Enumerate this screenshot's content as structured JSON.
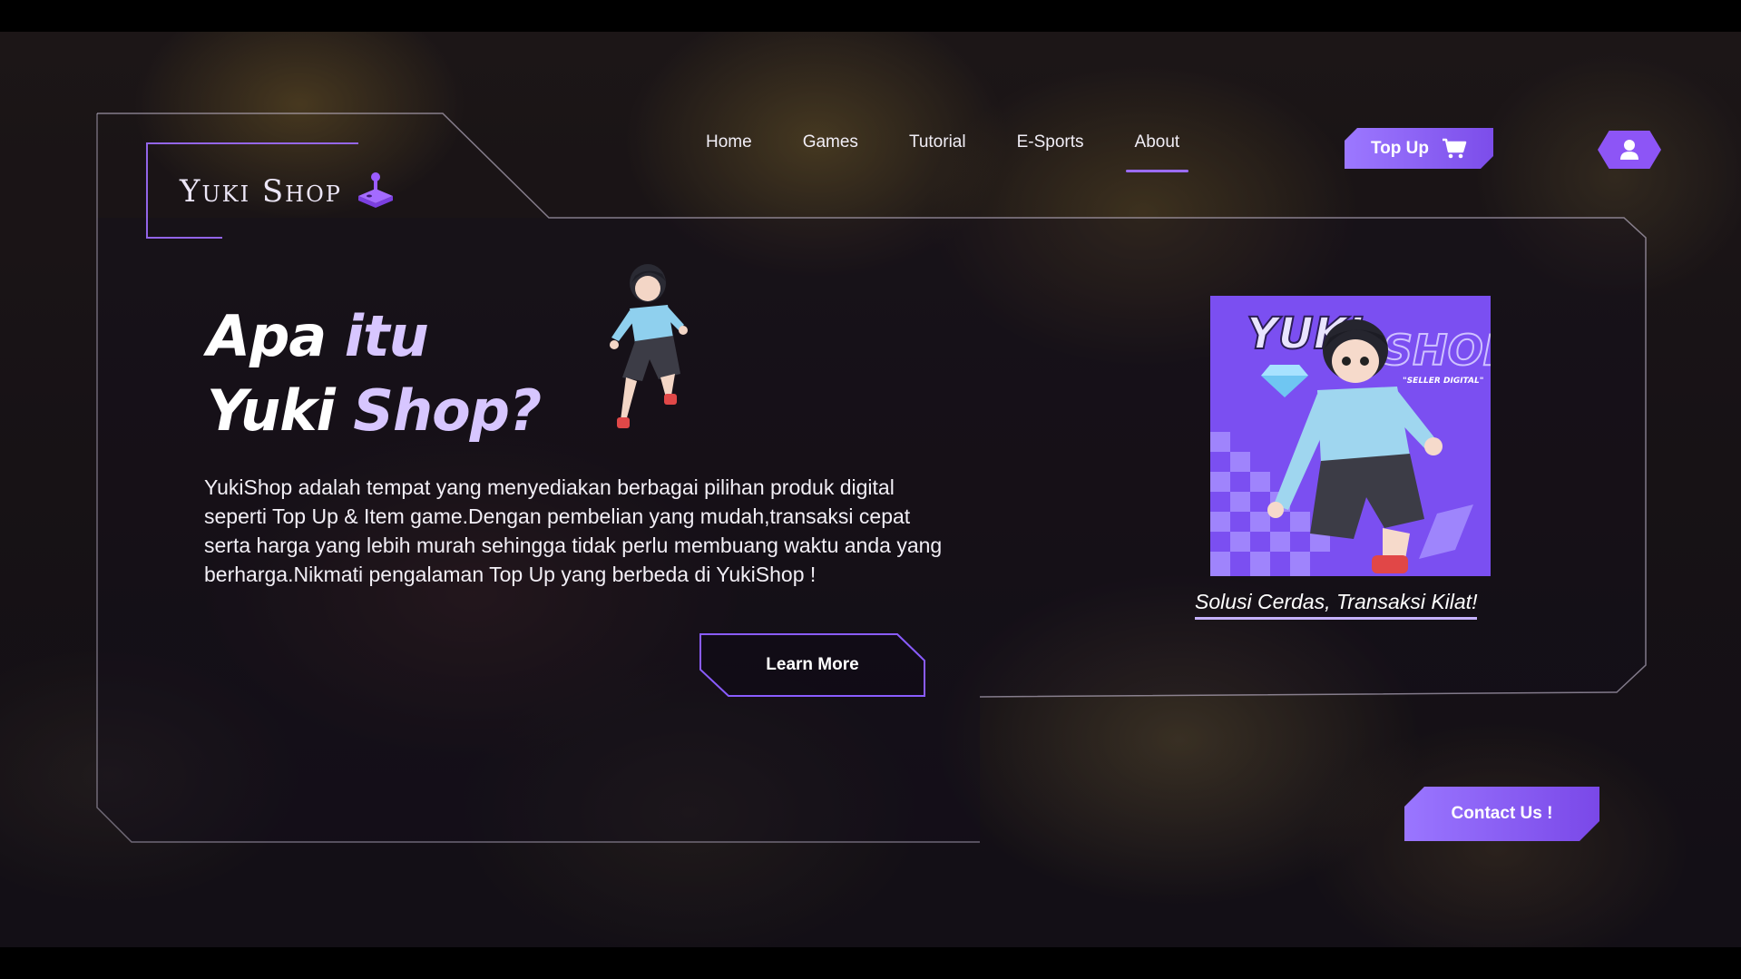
{
  "brand": {
    "name": "Yuki Shop",
    "logo_icon": "joystick-icon",
    "accent": "#8d55f6"
  },
  "nav": {
    "items": [
      {
        "label": "Home"
      },
      {
        "label": "Games"
      },
      {
        "label": "Tutorial"
      },
      {
        "label": "E-Sports"
      },
      {
        "label": "About",
        "active": true
      }
    ]
  },
  "header": {
    "topup_label": "Top Up",
    "topup_icon": "cart-icon",
    "user_icon": "user-icon"
  },
  "hero": {
    "title_line1_a": "Apa ",
    "title_line1_b": "itu",
    "title_line2_a": "Yuki ",
    "title_line2_b": "Shop?",
    "description": "YukiShop  adalah tempat yang menyediakan berbagai pilihan produk digital seperti Top Up & Item game.Dengan pembelian yang mudah,transaksi cepat serta harga yang lebih murah sehingga tidak perlu membuang waktu anda yang berharga.Nikmati pengalaman Top Up yang berbeda di YukiShop !",
    "learn_more_label": "Learn More"
  },
  "promo": {
    "card_title_a": "YUKI",
    "card_title_b": "SHOP",
    "card_subtitle": "\"SELLER DIGITAL\"",
    "caption": "Solusi Cerdas, Transaksi Kilat!"
  },
  "contact": {
    "label": "Contact Us !"
  }
}
